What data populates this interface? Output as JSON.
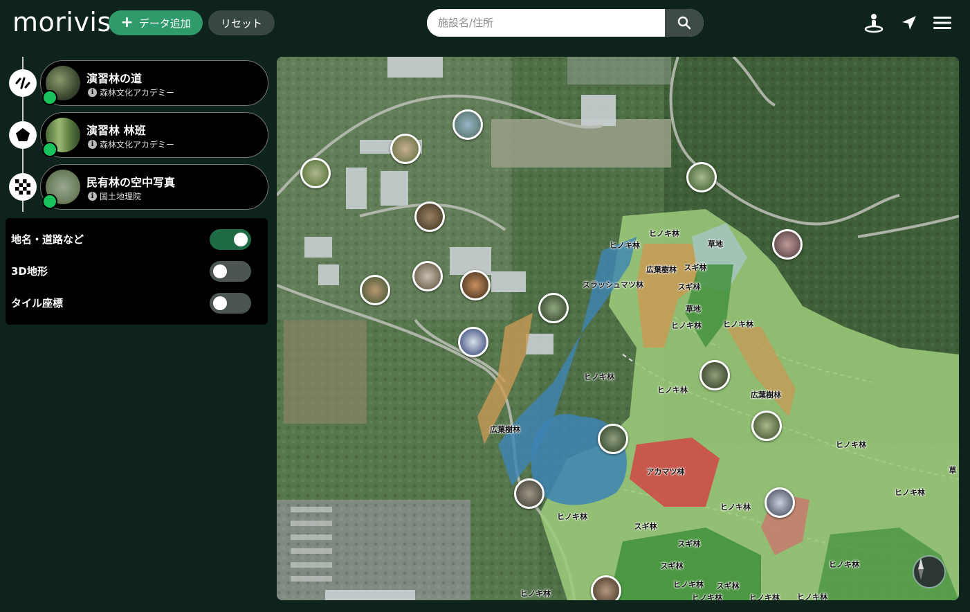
{
  "header": {
    "logo": "morivis",
    "add_data_label": "データ追加",
    "reset_label": "リセット",
    "search_placeholder": "施設名/住所"
  },
  "layers": [
    {
      "title": "演習林の道",
      "source": "森林文化アカデミー",
      "type_icon": "line-icon",
      "visible": true
    },
    {
      "title": "演習林 林班",
      "source": "森林文化アカデミー",
      "type_icon": "polygon-icon",
      "visible": true
    },
    {
      "title": "民有林の空中写真",
      "source": "国土地理院",
      "type_icon": "raster-icon",
      "visible": true
    }
  ],
  "options": [
    {
      "label": "地名・道路など",
      "on": true
    },
    {
      "label": "3D地形",
      "on": false
    },
    {
      "label": "タイル座標",
      "on": false
    }
  ],
  "map": {
    "labels": [
      "ヒノキ林",
      "ヒノキ林",
      "草地",
      "広葉樹林",
      "スギ林",
      "スラッシュマツ林",
      "スギ林",
      "草地",
      "ヒノキ林",
      "ヒノキ林",
      "ヒノキ林",
      "ヒノキ林",
      "広葉樹林",
      "広葉樹林",
      "ヒノキ林",
      "アカマツ林",
      "ヒノキ林",
      "ヒノキ林",
      "ヒノキ林",
      "スギ林",
      "スギ林",
      "ヒノキ林",
      "スギ林",
      "スギ林",
      "ヒノキ林",
      "ヒノキ林",
      "ヒノキ林",
      "ヒノキ林",
      "ヒノキ林",
      "草"
    ],
    "colors": {
      "hinoki": "#9cc97a",
      "sugi": "#3f8f3a",
      "koyoju": "#c99a55",
      "slash": "#3d84b5",
      "akamatsu": "#cf4a45",
      "sochi": "#a8c7cc"
    }
  }
}
